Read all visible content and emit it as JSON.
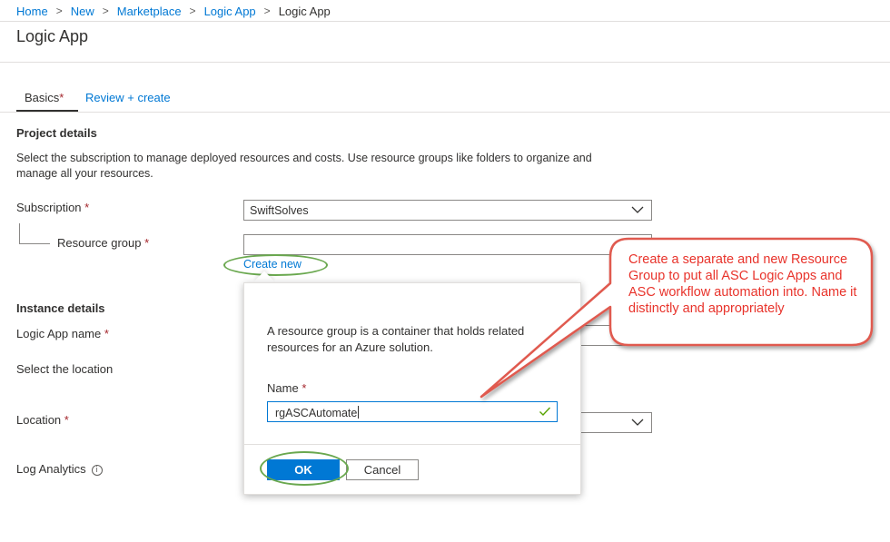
{
  "breadcrumb": {
    "items": [
      "Home",
      "New",
      "Marketplace",
      "Logic App"
    ],
    "current": "Logic App",
    "separator": ">"
  },
  "page": {
    "title": "Logic App"
  },
  "tabs": {
    "basics": "Basics",
    "review": "Review + create",
    "required_mark": "*"
  },
  "project": {
    "title": "Project details",
    "description": "Select the subscription to manage deployed resources and costs. Use resource groups like folders to organize and manage all your resources.",
    "subscription_label": "Subscription",
    "subscription_value": "SwiftSolves",
    "resource_group_label": "Resource group",
    "resource_group_value": "",
    "create_new": "Create new"
  },
  "instance": {
    "title": "Instance details",
    "logic_app_name_label": "Logic App name",
    "select_location_label": "Select the location",
    "location_label": "Location",
    "log_analytics_label": "Log Analytics",
    "info_glyph": "i"
  },
  "popup": {
    "description": "A resource group is a container that holds related resources for an Azure solution.",
    "name_label": "Name",
    "name_value": "rgASCAutomate",
    "ok_label": "OK",
    "cancel_label": "Cancel"
  },
  "callout": {
    "text": "Create a separate and new Resource Group to put all ASC Logic Apps and ASC workflow automation into. Name it distinctly and appropriately"
  },
  "colors": {
    "accent": "#0078d4",
    "required": "#a4262c",
    "callout_red": "#e8332b",
    "highlight_green": "#6aa84f"
  }
}
